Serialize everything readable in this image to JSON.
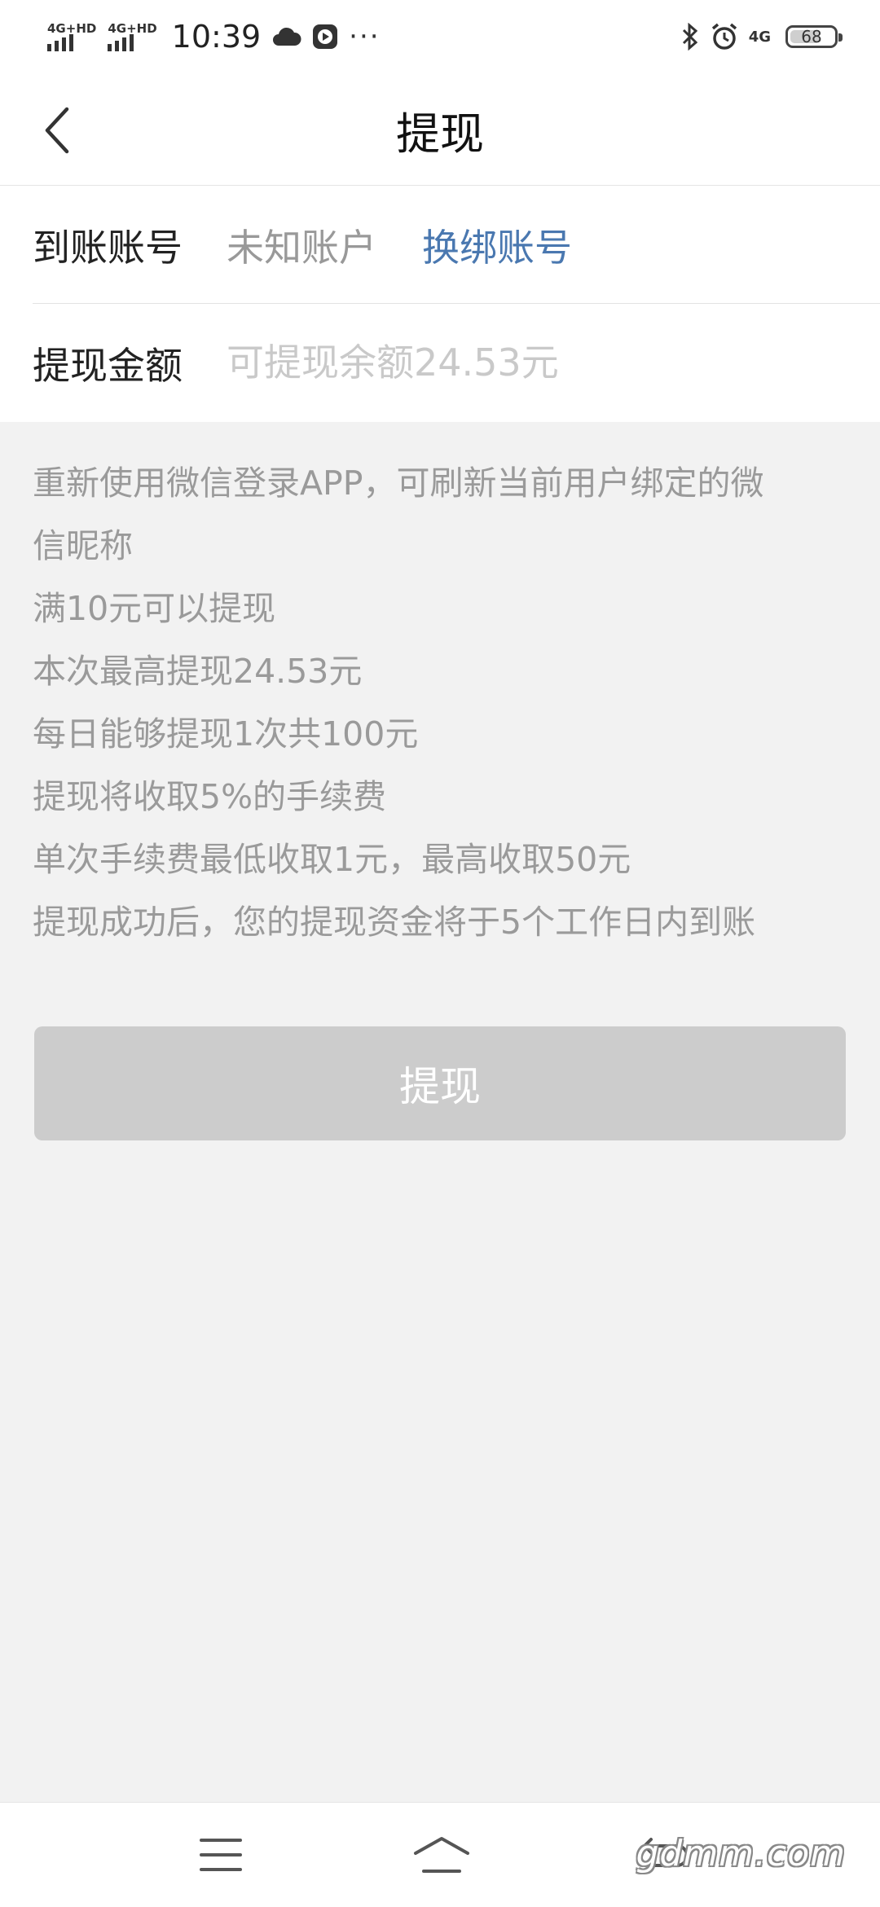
{
  "status_bar": {
    "sim1_label": "4G+HD",
    "sim2_label": "4G+HD",
    "time": "10:39",
    "overflow": "···",
    "network": "4G",
    "battery_level": "68"
  },
  "header": {
    "title": "提现",
    "back_icon": "chevron-left-icon"
  },
  "form": {
    "account_label": "到账账号",
    "account_value": "未知账户",
    "change_account_link": "换绑账号",
    "amount_label": "提现金额",
    "amount_placeholder": "可提现余额24.53元",
    "amount_value": ""
  },
  "notes": [
    "重新使用微信登录APP，可刷新当前用户绑定的微",
    "信昵称",
    "满10元可以提现",
    "本次最高提现24.53元",
    "每日能够提现1次共100元",
    "提现将收取5%的手续费",
    "单次手续费最低收取1元，最高收取50元",
    "提现成功后，您的提现资金将于5个工作日内到账"
  ],
  "submit_button": {
    "label": "提现",
    "enabled": false
  },
  "nav_bar": {
    "menu_icon": "menu-icon",
    "home_icon": "home-icon",
    "back_icon": "back-icon"
  },
  "watermark": "gdmm.com",
  "colors": {
    "link": "#4a78b0",
    "button_disabled": "#cccccc",
    "background": "#f2f2f2"
  }
}
